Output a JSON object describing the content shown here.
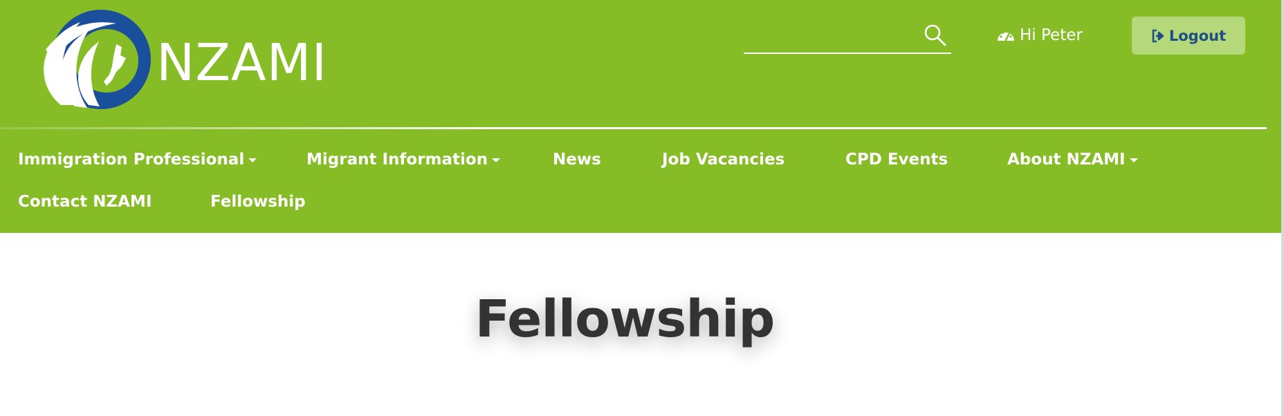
{
  "brand": {
    "name": "NZAMI",
    "colors": {
      "header_bg": "#86bc25",
      "logo_blue": "#1a4f9c",
      "logout_bg": "#b5d87a",
      "logout_text": "#1d4e86",
      "title_text": "#333333"
    }
  },
  "search": {
    "value": "",
    "placeholder": "",
    "icon": "search-icon"
  },
  "user": {
    "greeting": "Hi Peter",
    "icon": "dashboard-icon"
  },
  "logout": {
    "label": "Logout",
    "icon": "sign-out-icon"
  },
  "nav": {
    "items": [
      {
        "label": "Immigration Professional",
        "dropdown": true
      },
      {
        "label": "Migrant Information",
        "dropdown": true
      },
      {
        "label": "News",
        "dropdown": false
      },
      {
        "label": "Job Vacancies",
        "dropdown": false
      },
      {
        "label": "CPD Events",
        "dropdown": false
      },
      {
        "label": "About NZAMI",
        "dropdown": true
      },
      {
        "label": "Contact NZAMI",
        "dropdown": false
      },
      {
        "label": "Fellowship",
        "dropdown": false
      }
    ]
  },
  "page": {
    "title": "Fellowship"
  }
}
